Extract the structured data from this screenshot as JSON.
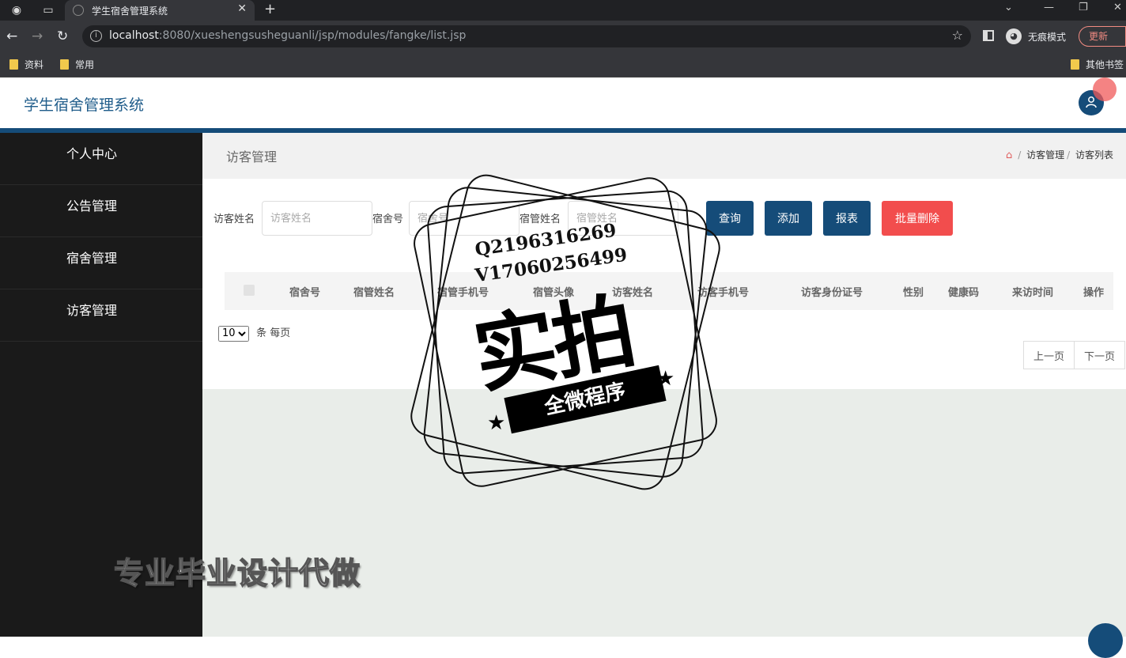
{
  "browser": {
    "tab_title": "学生宿舍管理系统",
    "url_host": "localhost",
    "url_rest": ":8080/xueshengsusheguanli/jsp/modules/fangke/list.jsp",
    "incognito_label": "无痕模式",
    "update_label": "更新",
    "bookmarks": [
      "资料",
      "常用"
    ],
    "other_bookmarks": "其他书签"
  },
  "app": {
    "title": "学生宿舍管理系统"
  },
  "sidebar": {
    "items": [
      {
        "label": "个人中心"
      },
      {
        "label": "公告管理"
      },
      {
        "label": "宿舍管理"
      },
      {
        "label": "访客管理"
      }
    ]
  },
  "page": {
    "title": "访客管理",
    "breadcrumb": [
      "访客管理",
      "访客列表"
    ]
  },
  "search": {
    "visitor_name_label": "访客姓名",
    "visitor_name_placeholder": "访客姓名",
    "dorm_no_label": "宿舍号",
    "dorm_no_placeholder": "宿舍号",
    "manager_name_label": "宿管姓名",
    "manager_name_placeholder": "宿管姓名"
  },
  "buttons": {
    "query": "查询",
    "add": "添加",
    "report": "报表",
    "batch_delete": "批量删除"
  },
  "table": {
    "columns": [
      "宿舍号",
      "宿管姓名",
      "宿管手机号",
      "宿管头像",
      "访客姓名",
      "访客手机号",
      "访客身份证号",
      "性别",
      "健康码",
      "来访时间",
      "操作"
    ]
  },
  "pagination": {
    "page_size": "10",
    "page_size_suffix": "条 每页",
    "prev": "上一页",
    "next": "下一页"
  },
  "watermark": {
    "qq": "Q2196316269",
    "vx": "V17060256499",
    "big": "实拍",
    "ribbon": "全微程序",
    "promo": "专业毕业设计代做"
  },
  "colors": {
    "primary": "#154c79",
    "danger": "#f24d4d"
  }
}
